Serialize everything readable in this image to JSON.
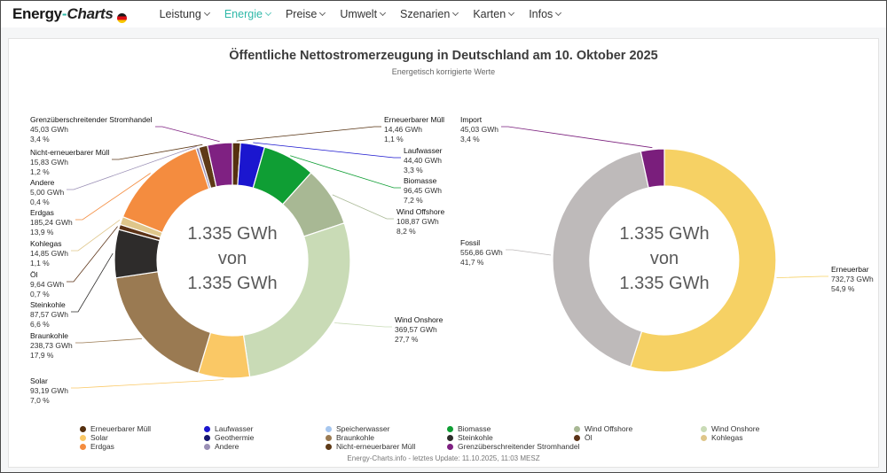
{
  "header": {
    "logo": {
      "text_bold": "Energy",
      "dash": "-",
      "text_italic": "Charts"
    },
    "nav": [
      {
        "label": "Leistung"
      },
      {
        "label": "Energie",
        "active": true
      },
      {
        "label": "Preise"
      },
      {
        "label": "Umwelt"
      },
      {
        "label": "Szenarien"
      },
      {
        "label": "Karten"
      },
      {
        "label": "Infos"
      }
    ]
  },
  "title": "Öffentliche Nettostromerzeugung in Deutschland am 10. Oktober 2025",
  "subtitle": "Energetisch korrigierte Werte",
  "footer": "Energy-Charts.info - letztes Update: 11.10.2025, 11:03 MESZ",
  "palette": {
    "Erneuerbarer Müll": "#55300f",
    "Solar": "#fac865",
    "Erdgas": "#f48c3f",
    "Laufwasser": "#1b16cf",
    "Geothermie": "#16166e",
    "Andere": "#9a8fb5",
    "Speicherwasser": "#a6c6ee",
    "Braunkohle": "#9a7a52",
    "Nicht-erneuerbarer Müll": "#5e3a17",
    "Biomasse": "#0f9e34",
    "Steinkohle": "#2e2c2b",
    "Grenzüberschreitender Stromhandel": "#7f2182",
    "Wind Offshore": "#a8b894",
    "Öl": "#5c3317",
    "Wind Onshore": "#c9dbb6",
    "Kohlegas": "#dfc68a",
    "Erneuerbar": "#f6d164",
    "Fossil": "#bebaba",
    "Import": "#7a1e7c"
  },
  "chart_data": [
    {
      "type": "pie",
      "subtype": "donut",
      "total_label": "1.335 GWh",
      "center_text": [
        "1.335 GWh",
        "von",
        "1.335 GWh"
      ],
      "unit": "GWh",
      "segments": [
        {
          "name": "Erneuerbarer Müll",
          "gwh": 14.46,
          "value_label": "14,46 GWh",
          "percent": 1.1,
          "percent_label": "1,1 %"
        },
        {
          "name": "Laufwasser",
          "gwh": 44.4,
          "value_label": "44,40 GWh",
          "percent": 3.3,
          "percent_label": "3,3 %"
        },
        {
          "name": "Biomasse",
          "gwh": 96.45,
          "value_label": "96,45 GWh",
          "percent": 7.2,
          "percent_label": "7,2 %"
        },
        {
          "name": "Wind Offshore",
          "gwh": 108.87,
          "value_label": "108,87 GWh",
          "percent": 8.2,
          "percent_label": "8,2 %"
        },
        {
          "name": "Wind Onshore",
          "gwh": 369.57,
          "value_label": "369,57 GWh",
          "percent": 27.7,
          "percent_label": "27,7 %"
        },
        {
          "name": "Solar",
          "gwh": 93.19,
          "value_label": "93,19 GWh",
          "percent": 7.0,
          "percent_label": "7,0 %"
        },
        {
          "name": "Braunkohle",
          "gwh": 238.73,
          "value_label": "238,73 GWh",
          "percent": 17.9,
          "percent_label": "17,9 %"
        },
        {
          "name": "Steinkohle",
          "gwh": 87.57,
          "value_label": "87,57 GWh",
          "percent": 6.6,
          "percent_label": "6,6 %"
        },
        {
          "name": "Öl",
          "gwh": 9.64,
          "value_label": "9,64 GWh",
          "percent": 0.7,
          "percent_label": "0,7 %"
        },
        {
          "name": "Kohlegas",
          "gwh": 14.85,
          "value_label": "14,85 GWh",
          "percent": 1.1,
          "percent_label": "1,1 %"
        },
        {
          "name": "Erdgas",
          "gwh": 185.24,
          "value_label": "185,24 GWh",
          "percent": 13.9,
          "percent_label": "13,9 %"
        },
        {
          "name": "Andere",
          "gwh": 5.0,
          "value_label": "5,00 GWh",
          "percent": 0.4,
          "percent_label": "0,4 %"
        },
        {
          "name": "Nicht-erneuerbarer Müll",
          "gwh": 15.83,
          "value_label": "15,83 GWh",
          "percent": 1.2,
          "percent_label": "1,2 %"
        },
        {
          "name": "Grenzüberschreitender Stromhandel",
          "gwh": 45.03,
          "value_label": "45,03 GWh",
          "percent": 3.4,
          "percent_label": "3,4 %"
        }
      ]
    },
    {
      "type": "pie",
      "subtype": "donut",
      "total_label": "1.335 GWh",
      "center_text": [
        "1.335 GWh",
        "von",
        "1.335 GWh"
      ],
      "unit": "GWh",
      "segments": [
        {
          "name": "Erneuerbar",
          "gwh": 732.73,
          "value_label": "732,73 GWh",
          "percent": 54.9,
          "percent_label": "54,9 %"
        },
        {
          "name": "Fossil",
          "gwh": 556.86,
          "value_label": "556,86 GWh",
          "percent": 41.7,
          "percent_label": "41,7 %"
        },
        {
          "name": "Import",
          "gwh": 45.03,
          "value_label": "45,03 GWh",
          "percent": 3.4,
          "percent_label": "3,4 %"
        }
      ]
    }
  ],
  "legend": {
    "columns": [
      [
        "Erneuerbarer Müll",
        "Solar",
        "Erdgas"
      ],
      [
        "Laufwasser",
        "Geothermie",
        "Andere"
      ],
      [
        "Speicherwasser",
        "Braunkohle",
        "Nicht-erneuerbarer Müll"
      ],
      [
        "Biomasse",
        "Steinkohle",
        "Grenzüberschreitender Stromhandel"
      ],
      [
        "Wind Offshore",
        "Öl"
      ],
      [
        "Wind Onshore",
        "Kohlegas"
      ]
    ]
  }
}
